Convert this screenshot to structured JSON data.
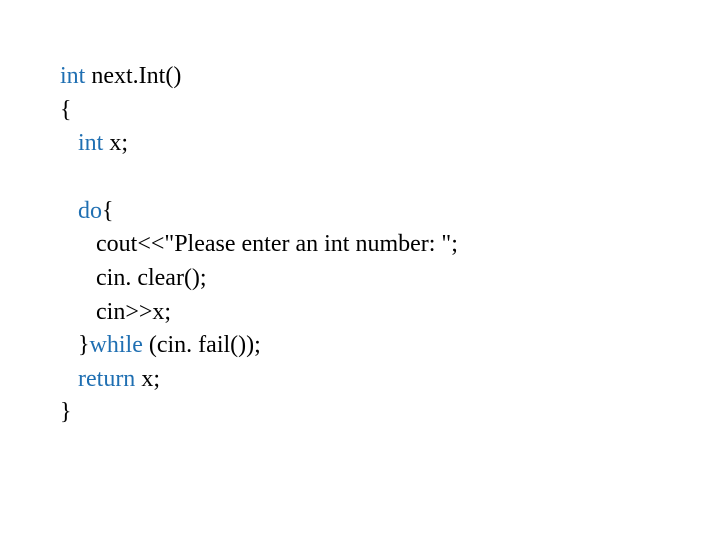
{
  "code": {
    "l1_kw": "int",
    "l1_rest": " next.Int()",
    "l2": "{",
    "l3_kw": "   int",
    "l3_rest": " x;",
    "l4_kw": "   do",
    "l4_rest": "{",
    "l5": "      cout<<\"Please enter an int number: \";",
    "l6": "      cin. clear();",
    "l7": "      cin>>x;",
    "l8_a": "   }",
    "l8_kw": "while",
    "l8_b": " (cin. fail());",
    "l9_kw": "   return",
    "l9_rest": " x;",
    "l10": "}"
  }
}
